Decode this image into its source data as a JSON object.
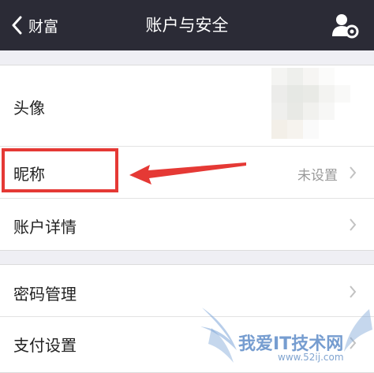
{
  "colors": {
    "navbar": "#2b2b36",
    "highlight": "#e53935",
    "watermark": "#5f8cc8"
  },
  "navbar": {
    "back_label": "财富",
    "title": "账户与安全",
    "action_icon": "contact-settings-icon"
  },
  "section1": {
    "avatar": {
      "label": "头像"
    },
    "nickname": {
      "label": "昵称",
      "value": "未设置"
    },
    "account_details": {
      "label": "账户详情"
    }
  },
  "section2": {
    "password": {
      "label": "密码管理"
    },
    "payment": {
      "label": "支付设置"
    }
  },
  "watermark": {
    "text": "我爱IT技术网",
    "url": "www.52ij.com"
  }
}
